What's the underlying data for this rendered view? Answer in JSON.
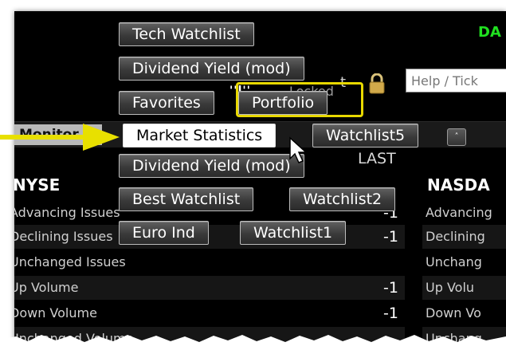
{
  "header": {
    "da_label": "DA",
    "t_label": "t",
    "locked_label": "Locked",
    "dots": "''l''",
    "help_placeholder": "Help / Tick"
  },
  "tabs": {
    "monitor_label": "Monitor",
    "more_button": "˄"
  },
  "last_label": "LAST",
  "watchlist_menu": [
    {
      "label": "Tech Watchlist"
    },
    {
      "label": "Dividend Yield (mod)"
    },
    {
      "label": "Favorites"
    },
    {
      "label": "Portfolio"
    },
    {
      "label": "Market Statistics"
    },
    {
      "label": "Watchlist5"
    },
    {
      "label": "Dividend Yield (mod)"
    },
    {
      "label": "Best Watchlist"
    },
    {
      "label": "Watchlist2"
    },
    {
      "label": "Euro Ind"
    },
    {
      "label": "Watchlist1"
    }
  ],
  "nyse": {
    "title": "NYSE",
    "rows": [
      {
        "label": "Advancing Issues",
        "value": "-1"
      },
      {
        "label": "Declining Issues",
        "value": "-1"
      },
      {
        "label": "Unchanged Issues",
        "value": ""
      },
      {
        "label": "Up Volume",
        "value": "-1"
      },
      {
        "label": "Down Volume",
        "value": "-1"
      },
      {
        "label": "Unchanged Volume",
        "value": ""
      }
    ]
  },
  "nasdaq": {
    "title": "NASDA",
    "rows": [
      {
        "label": "Advancing"
      },
      {
        "label": "Declining"
      },
      {
        "label": "Unchang"
      },
      {
        "label": "Up Volu"
      },
      {
        "label": "Down Vo"
      },
      {
        "label": "Unchang"
      }
    ]
  },
  "colors": {
    "highlight_yellow": "#e8d800",
    "da_green": "#20e020"
  }
}
